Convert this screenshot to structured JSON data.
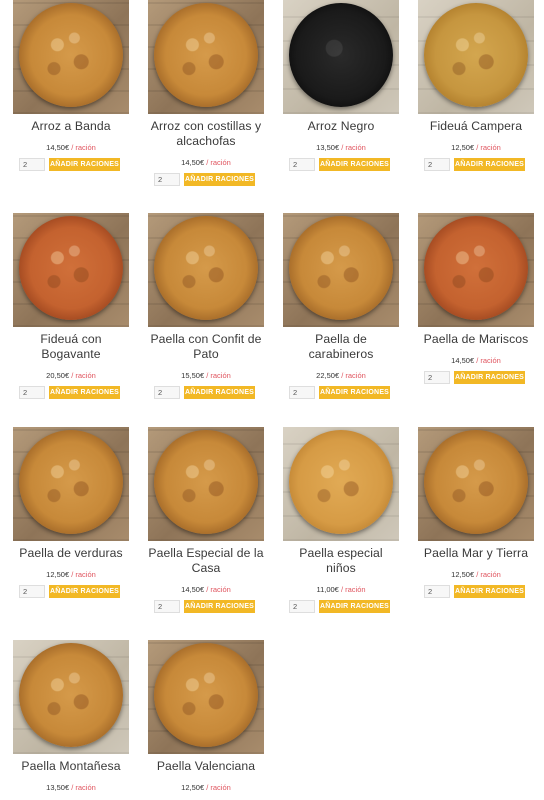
{
  "products": [
    {
      "name": "Arroz a Banda",
      "price": "14,50€",
      "unit": "/ ración",
      "qty": "2",
      "button": "AÑADIR RACIONES"
    },
    {
      "name": "Arroz con costillas y alcachofas",
      "price": "14,50€",
      "unit": "/ ración",
      "qty": "2",
      "button": "AÑADIR RACIONES"
    },
    {
      "name": "Arroz Negro",
      "price": "13,50€",
      "unit": "/ ración",
      "qty": "2",
      "button": "AÑADIR RACIONES"
    },
    {
      "name": "Fideuá Campera",
      "price": "12,50€",
      "unit": "/ ración",
      "qty": "2",
      "button": "AÑADIR RACIONES"
    },
    {
      "name": "Fideuá con Bogavante",
      "price": "20,50€",
      "unit": "/ ración",
      "qty": "2",
      "button": "AÑADIR RACIONES"
    },
    {
      "name": "Paella con Confit de Pato",
      "price": "15,50€",
      "unit": "/ ración",
      "qty": "2",
      "button": "AÑADIR RACIONES"
    },
    {
      "name": "Paella de carabineros",
      "price": "22,50€",
      "unit": "/ ración",
      "qty": "2",
      "button": "AÑADIR RACIONES"
    },
    {
      "name": "Paella de Mariscos",
      "price": "14,50€",
      "unit": "/ ración",
      "qty": "2",
      "button": "AÑADIR RACIONES"
    },
    {
      "name": "Paella de verduras",
      "price": "12,50€",
      "unit": "/ ración",
      "qty": "2",
      "button": "AÑADIR RACIONES"
    },
    {
      "name": "Paella Especial de la Casa",
      "price": "14,50€",
      "unit": "/ ración",
      "qty": "2",
      "button": "AÑADIR RACIONES"
    },
    {
      "name": "Paella especial niños",
      "price": "11,00€",
      "unit": "/ ración",
      "qty": "2",
      "button": "AÑADIR RACIONES"
    },
    {
      "name": "Paella Mar y Tierra",
      "price": "12,50€",
      "unit": "/ ración",
      "qty": "2",
      "button": "AÑADIR RACIONES"
    },
    {
      "name": "Paella Montañesa",
      "price": "13,50€",
      "unit": "/ ración"
    },
    {
      "name": "Paella Valenciana",
      "price": "12,50€",
      "unit": "/ ración"
    }
  ],
  "colors": {
    "accent": "#f2b825",
    "unit_text": "#e0555f"
  }
}
